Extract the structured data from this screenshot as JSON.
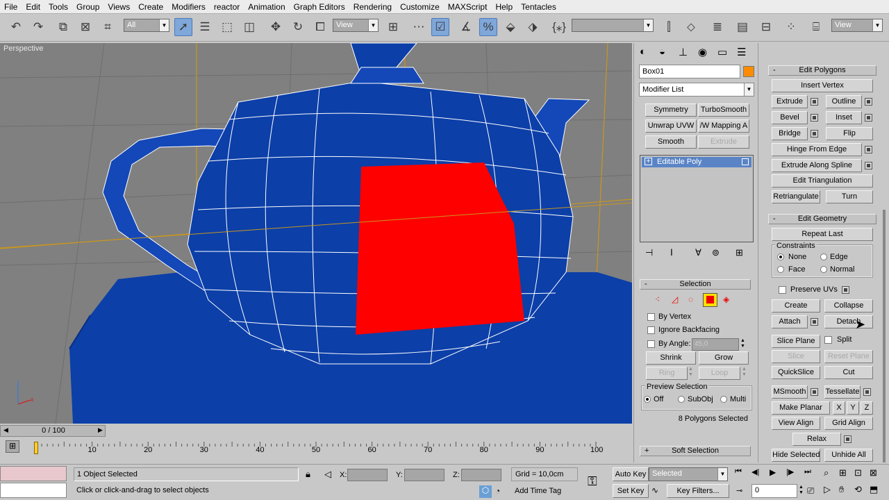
{
  "menu": [
    "File",
    "Edit",
    "Tools",
    "Group",
    "Views",
    "Create",
    "Modifiers",
    "reactor",
    "Animation",
    "Graph Editors",
    "Rendering",
    "Customize",
    "MAXScript",
    "Help",
    "Tentacles"
  ],
  "toolbar": {
    "selection_filter": "All",
    "ref_coord": "View",
    "named_sel": "",
    "view2": "View",
    "percent_label": "%"
  },
  "viewport": {
    "label": "Perspective",
    "axis_z": "z",
    "axis_x": "x"
  },
  "object": {
    "name": "Box01",
    "color": "#ff8c00",
    "modifier_list": "Modifier List"
  },
  "modifier_buttons": [
    {
      "label": "Symmetry",
      "enabled": true
    },
    {
      "label": "TurboSmooth",
      "enabled": true
    },
    {
      "label": "Unwrap UVW",
      "enabled": true
    },
    {
      "label": "/W Mapping A",
      "enabled": true
    },
    {
      "label": "Smooth",
      "enabled": true
    },
    {
      "label": "Extrude",
      "enabled": false
    }
  ],
  "stack": {
    "item": "Editable Poly"
  },
  "selection": {
    "title": "Selection",
    "by_vertex": "By Vertex",
    "ignore_backfacing": "Ignore Backfacing",
    "by_angle": "By Angle:",
    "angle_value": "45,0",
    "shrink": "Shrink",
    "grow": "Grow",
    "ring": "Ring",
    "loop": "Loop",
    "preview_title": "Preview Selection",
    "preview_off": "Off",
    "preview_subobj": "SubObj",
    "preview_multi": "Multi",
    "status": "8 Polygons Selected",
    "soft_selection": "Soft Selection"
  },
  "edit_polygons": {
    "title": "Edit Polygons",
    "insert_vertex": "Insert Vertex",
    "extrude": "Extrude",
    "outline": "Outline",
    "bevel": "Bevel",
    "inset": "Inset",
    "bridge": "Bridge",
    "flip": "Flip",
    "hinge": "Hinge From Edge",
    "extrude_spline": "Extrude Along Spline",
    "edit_triangulation": "Edit Triangulation",
    "retriangulate": "Retriangulate",
    "turn": "Turn"
  },
  "edit_geometry": {
    "title": "Edit Geometry",
    "repeat_last": "Repeat Last",
    "constraints": "Constraints",
    "none": "None",
    "edge": "Edge",
    "face": "Face",
    "normal": "Normal",
    "preserve_uvs": "Preserve UVs",
    "create": "Create",
    "collapse": "Collapse",
    "attach": "Attach",
    "detach": "Detach",
    "slice_plane": "Slice Plane",
    "split": "Split",
    "slice": "Slice",
    "reset_plane": "Reset Plane",
    "quickslice": "QuickSlice",
    "cut": "Cut",
    "msmooth": "MSmooth",
    "tessellate": "Tessellate",
    "make_planar": "Make Planar",
    "x": "X",
    "y": "Y",
    "z": "Z",
    "view_align": "View Align",
    "grid_align": "Grid Align",
    "relax": "Relax",
    "hide_selected": "Hide Selected",
    "unhide_all": "Unhide All"
  },
  "timeline": {
    "frame": "0 / 100",
    "ticks": [
      "10",
      "20",
      "30",
      "40",
      "50",
      "60",
      "70",
      "80",
      "90",
      "100"
    ],
    "progress": 0.0
  },
  "status": {
    "objects": "1 Object Selected",
    "prompt": "Click or click-and-drag to select objects",
    "x_label": "X:",
    "y_label": "Y:",
    "z_label": "Z:",
    "grid": "Grid = 10,0cm",
    "add_time_tag": "Add Time Tag",
    "auto_key": "Auto Key",
    "set_key": "Set Key",
    "selected": "Selected",
    "key_filters": "Key Filters...",
    "frame": "0"
  },
  "colors": {
    "teapot": "#0c3fa8",
    "selection": "#ff0000",
    "viewport_bg": "#808080",
    "active_button": "#7fa7d9"
  }
}
